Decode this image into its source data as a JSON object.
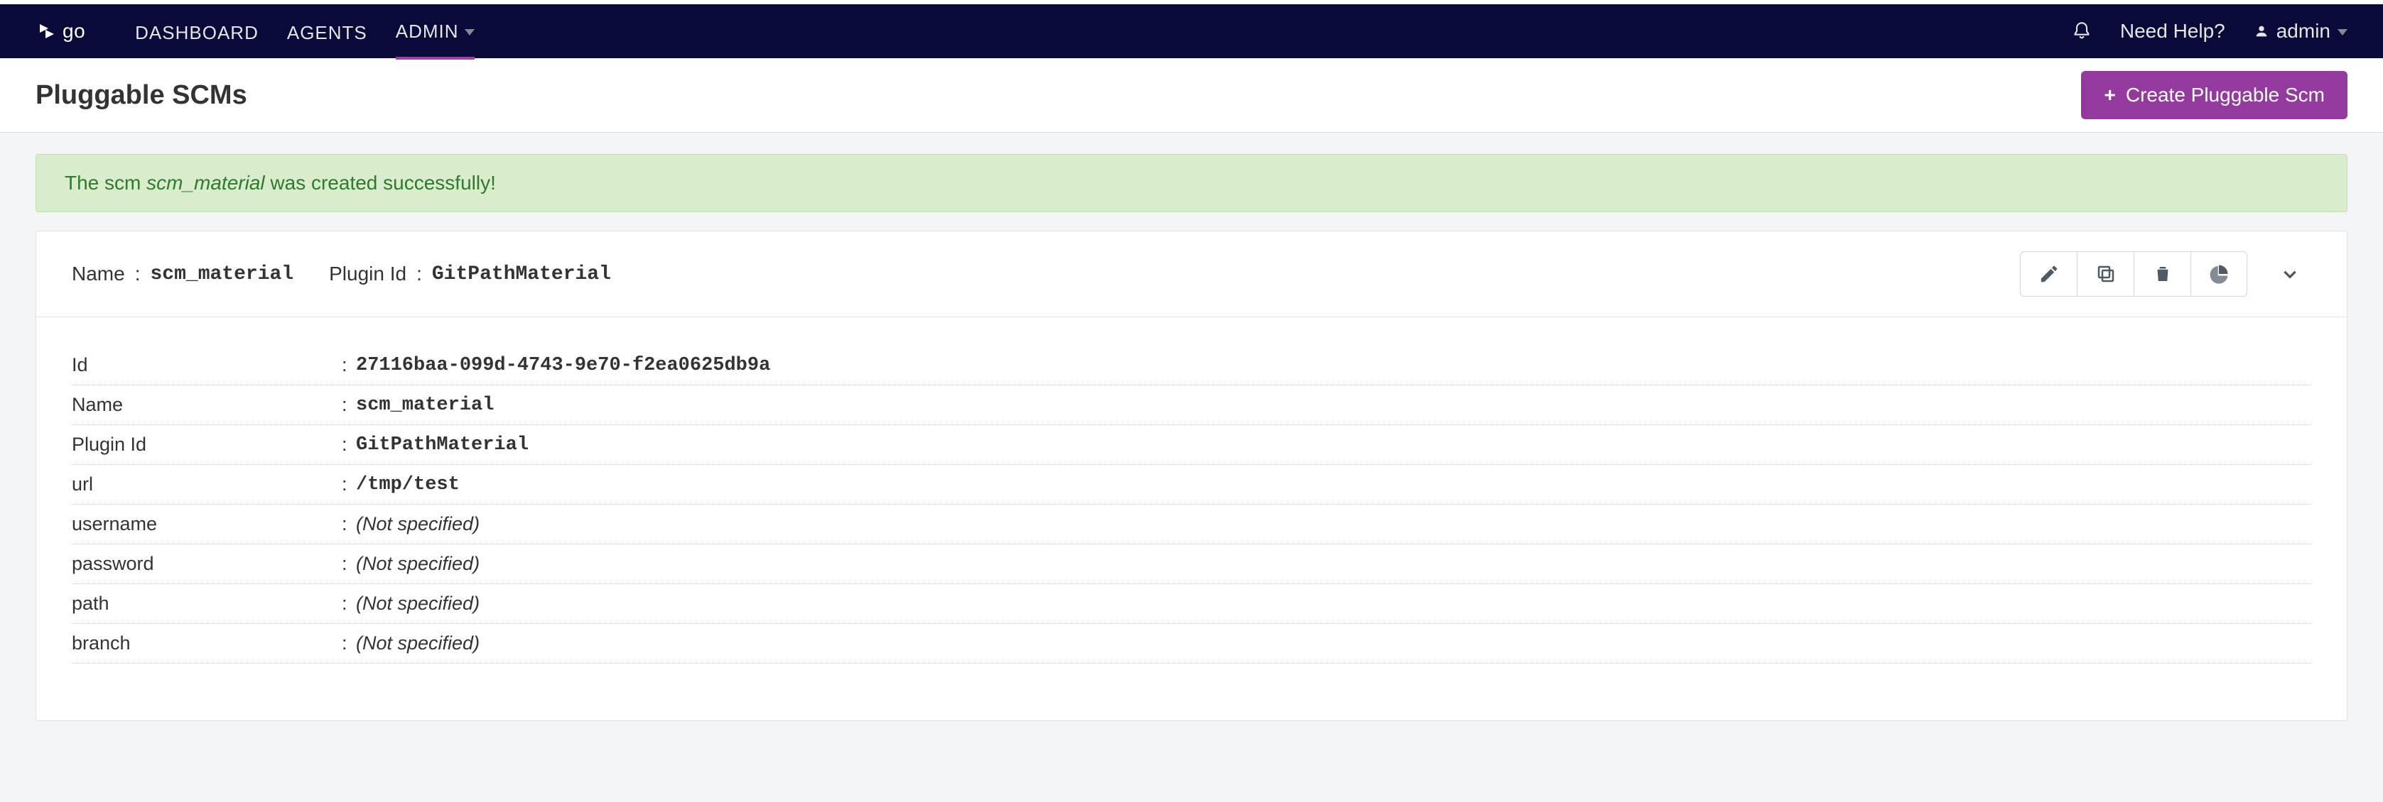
{
  "nav": {
    "dashboard": "DASHBOARD",
    "agents": "AGENTS",
    "admin": "ADMIN",
    "help": "Need Help?",
    "user": "admin"
  },
  "page": {
    "title": "Pluggable SCMs",
    "create_btn": "Create Pluggable Scm"
  },
  "alert": {
    "prefix": "The scm ",
    "em": "scm_material",
    "suffix": " was created successfully!"
  },
  "scm": {
    "header": {
      "name_label": "Name",
      "name_value": "scm_material",
      "plugin_label": "Plugin Id",
      "plugin_value": "GitPathMaterial"
    },
    "not_specified": "(Not specified)",
    "rows": [
      {
        "key": "Id",
        "value": "27116baa-099d-4743-9e70-f2ea0625db9a",
        "specified": true
      },
      {
        "key": "Name",
        "value": "scm_material",
        "specified": true
      },
      {
        "key": "Plugin Id",
        "value": "GitPathMaterial",
        "specified": true
      },
      {
        "key": "url",
        "value": "/tmp/test",
        "specified": true
      },
      {
        "key": "username",
        "value": "",
        "specified": false
      },
      {
        "key": "password",
        "value": "",
        "specified": false
      },
      {
        "key": "path",
        "value": "",
        "specified": false
      },
      {
        "key": "branch",
        "value": "",
        "specified": false
      }
    ]
  }
}
